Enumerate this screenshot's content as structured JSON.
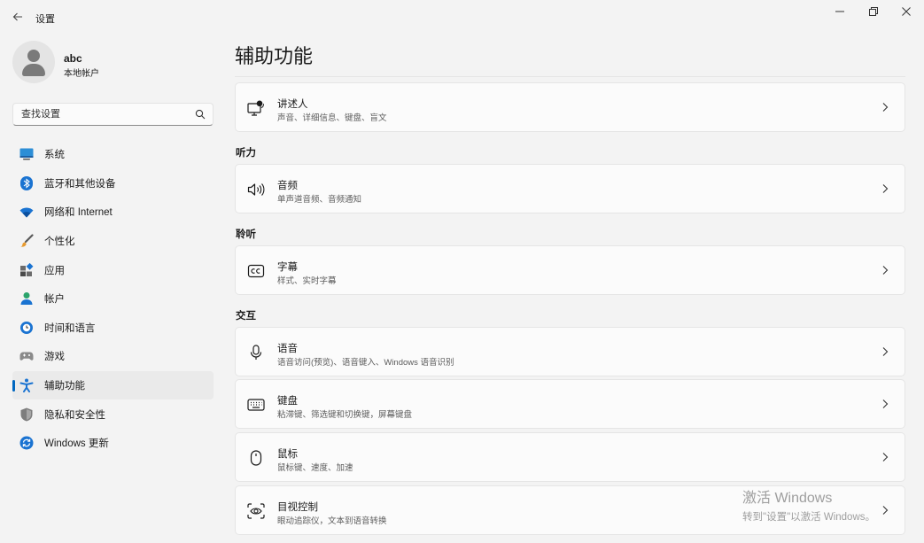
{
  "window": {
    "title": "设置",
    "controls": {
      "minimize": "—",
      "maximize": "❐",
      "close": "✕"
    }
  },
  "profile": {
    "name": "abc",
    "account_type": "本地帐户"
  },
  "search": {
    "placeholder": "查找设置",
    "value": ""
  },
  "sidebar": {
    "items": [
      {
        "label": "系统",
        "icon": "system-icon"
      },
      {
        "label": "蓝牙和其他设备",
        "icon": "bluetooth-icon"
      },
      {
        "label": "网络和 Internet",
        "icon": "wifi-icon"
      },
      {
        "label": "个性化",
        "icon": "brush-icon"
      },
      {
        "label": "应用",
        "icon": "apps-icon"
      },
      {
        "label": "帐户",
        "icon": "account-icon"
      },
      {
        "label": "时间和语言",
        "icon": "globe-clock-icon"
      },
      {
        "label": "游戏",
        "icon": "gamepad-icon"
      },
      {
        "label": "辅助功能",
        "icon": "accessibility-icon",
        "active": true
      },
      {
        "label": "隐私和安全性",
        "icon": "shield-icon"
      },
      {
        "label": "Windows 更新",
        "icon": "update-icon"
      }
    ]
  },
  "main": {
    "title": "辅助功能",
    "sections": [
      {
        "label": "",
        "cards": [
          {
            "title": "讲述人",
            "subtitle": "声音、详细信息、键盘、盲文",
            "icon": "narrator-icon"
          }
        ]
      },
      {
        "label": "听力",
        "cards": [
          {
            "title": "音频",
            "subtitle": "单声道音频、音频通知",
            "icon": "speaker-icon"
          }
        ]
      },
      {
        "label": "聆听",
        "cards": [
          {
            "title": "字幕",
            "subtitle": "样式、实时字幕",
            "icon": "captions-icon"
          }
        ]
      },
      {
        "label": "交互",
        "cards": [
          {
            "title": "语音",
            "subtitle": "语音访问(预览)、语音键入、Windows 语音识别",
            "icon": "microphone-icon"
          },
          {
            "title": "键盘",
            "subtitle": "粘滞键、筛选键和切换键，屏幕键盘",
            "icon": "keyboard-icon"
          },
          {
            "title": "鼠标",
            "subtitle": "鼠标键、速度、加速",
            "icon": "mouse-icon"
          },
          {
            "title": "目视控制",
            "subtitle": "眼动追踪仪，文本到语音转换",
            "icon": "eye-control-icon"
          }
        ]
      }
    ]
  },
  "activation_watermark": {
    "title": "激活 Windows",
    "subtitle": "转到\"设置\"以激活 Windows。"
  },
  "colors": {
    "accent": "#0067c0",
    "background": "#f3f3f3",
    "card": "#fbfbfb"
  }
}
